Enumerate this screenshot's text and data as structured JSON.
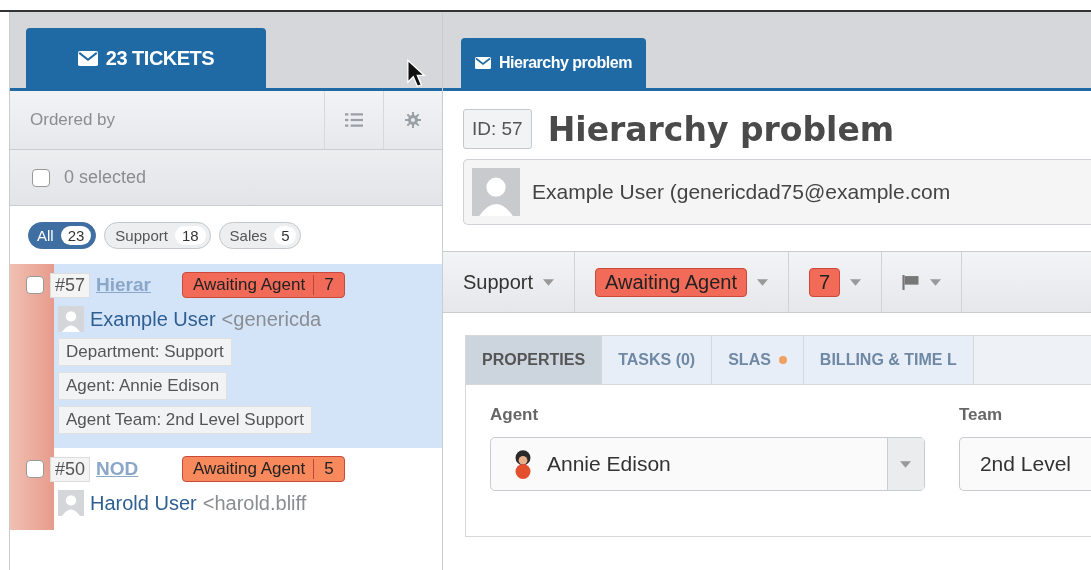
{
  "list_panel": {
    "tab": {
      "label": "23 TICKETS",
      "selected": true
    },
    "ordered_by": "Ordered by",
    "select_all": {
      "label": "0 selected",
      "checked": false
    },
    "filters": [
      {
        "label": "All",
        "count": "23",
        "selected": true
      },
      {
        "label": "Support",
        "count": "18",
        "selected": false
      },
      {
        "label": "Sales",
        "count": "5",
        "selected": false
      }
    ],
    "tickets": [
      {
        "id": "#57",
        "title": "Hierar",
        "status": "Awaiting Agent",
        "count": "7",
        "color": "#f26a58",
        "user": "Example User",
        "email": "<genericda",
        "checked": false,
        "selected": true,
        "tags": [
          "Department: Support",
          "Agent: Annie Edison",
          "Agent Team: 2nd Level Support"
        ]
      },
      {
        "id": "#50",
        "title": "NOD",
        "status": "Awaiting Agent",
        "count": "5",
        "color": "#f7895c",
        "user": "Harold User",
        "email": "<harold.bliff",
        "checked": false,
        "selected": false
      }
    ]
  },
  "detail": {
    "tab": {
      "label": "Hierarchy problem",
      "selected": true
    },
    "id": "ID: 57",
    "title": "Hierarchy problem",
    "person": "Example User (genericdad75@example.com",
    "toolbar": [
      {
        "kind": "text",
        "label": "Support"
      },
      {
        "kind": "status",
        "label": "Awaiting Agent"
      },
      {
        "kind": "urgency",
        "label": "7"
      },
      {
        "kind": "flag"
      }
    ],
    "tabs": [
      {
        "label": "PROPERTIES",
        "selected": true,
        "dot": false
      },
      {
        "label": "TASKS (0)",
        "selected": false,
        "dot": false
      },
      {
        "label": "SLAS",
        "selected": false,
        "dot": true
      },
      {
        "label": "BILLING & TIME L",
        "selected": false,
        "dot": false
      }
    ],
    "fields": [
      {
        "label": "Agent",
        "value": "Annie Edison",
        "avatar": true
      },
      {
        "label": "Team",
        "value": "2nd Level",
        "avatar": false
      }
    ]
  }
}
